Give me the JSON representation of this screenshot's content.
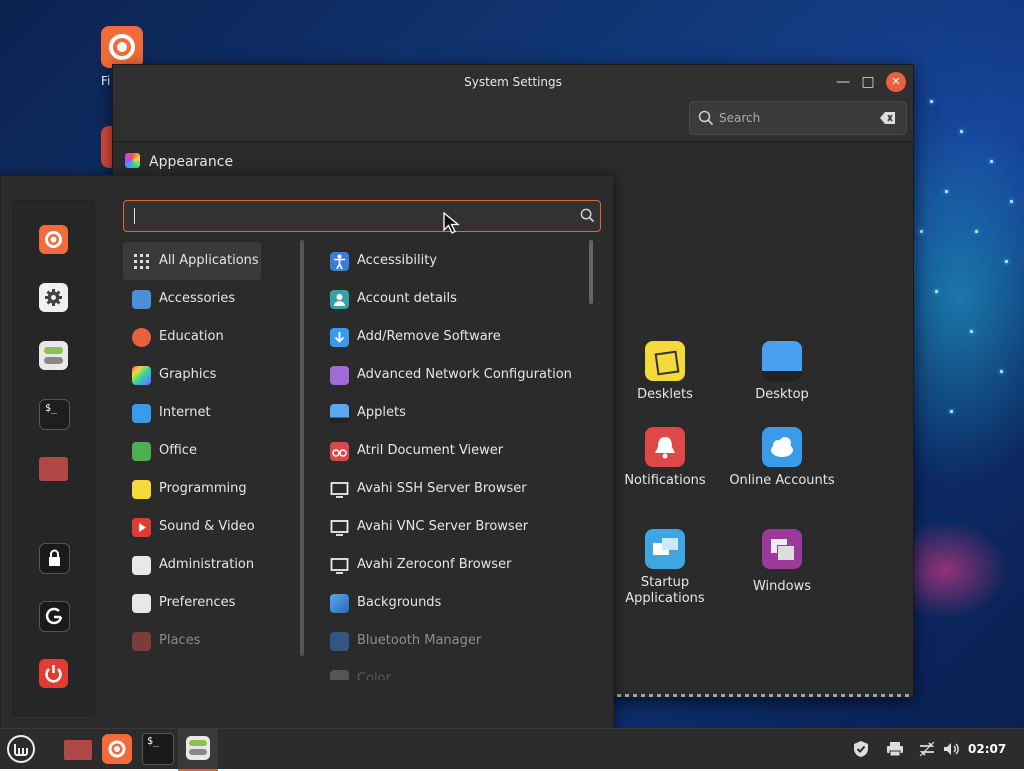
{
  "desktop": {
    "icons": [
      {
        "label": "Fi",
        "icon": "firefox-icon"
      },
      {
        "label": "",
        "icon": "chrome-icon"
      }
    ]
  },
  "settings_window": {
    "title": "System Settings",
    "search_placeholder": "Search",
    "section": "Appearance",
    "tiles": [
      {
        "label": "Desklets",
        "icon": "desklets-icon"
      },
      {
        "label": "Desktop",
        "icon": "desktop-icon"
      },
      {
        "label": "Notifications",
        "icon": "notifications-icon"
      },
      {
        "label": "Online Accounts",
        "icon": "online-accounts-icon"
      },
      {
        "label": "Startup Applications",
        "icon": "startup-applications-icon"
      },
      {
        "label": "Windows",
        "icon": "windows-icon"
      }
    ]
  },
  "menu": {
    "search_value": "",
    "favorites": [
      "firefox-icon",
      "settings-icon",
      "toggle-icon",
      "terminal-icon",
      "folder-icon",
      "lock-icon",
      "logout-icon",
      "power-icon"
    ],
    "categories": [
      {
        "label": "All Applications",
        "icon": "grid-icon",
        "selected": true
      },
      {
        "label": "Accessories",
        "icon": "accessories-icon"
      },
      {
        "label": "Education",
        "icon": "education-icon"
      },
      {
        "label": "Graphics",
        "icon": "graphics-icon"
      },
      {
        "label": "Internet",
        "icon": "internet-icon"
      },
      {
        "label": "Office",
        "icon": "office-icon"
      },
      {
        "label": "Programming",
        "icon": "programming-icon"
      },
      {
        "label": "Sound & Video",
        "icon": "sound-video-icon"
      },
      {
        "label": "Administration",
        "icon": "administration-icon"
      },
      {
        "label": "Preferences",
        "icon": "preferences-icon"
      },
      {
        "label": "Places",
        "icon": "places-icon",
        "dim": true
      }
    ],
    "apps": [
      {
        "label": "Accessibility",
        "icon": "accessibility-icon"
      },
      {
        "label": "Account details",
        "icon": "account-icon"
      },
      {
        "label": "Add/Remove Software",
        "icon": "software-icon"
      },
      {
        "label": "Advanced Network Configuration",
        "icon": "network-icon"
      },
      {
        "label": "Applets",
        "icon": "applets-icon"
      },
      {
        "label": "Atril Document Viewer",
        "icon": "atril-icon"
      },
      {
        "label": "Avahi SSH Server Browser",
        "icon": "monitor-icon"
      },
      {
        "label": "Avahi VNC Server Browser",
        "icon": "monitor-icon"
      },
      {
        "label": "Avahi Zeroconf Browser",
        "icon": "monitor-icon"
      },
      {
        "label": "Backgrounds",
        "icon": "backgrounds-icon"
      },
      {
        "label": "Bluetooth Manager",
        "icon": "bluetooth-icon",
        "dim": true
      },
      {
        "label": "Color",
        "icon": "color-icon",
        "dim": true
      }
    ]
  },
  "panel": {
    "clock": "02:07",
    "tray": [
      "shield-icon",
      "printer-icon",
      "network-icon",
      "volume-icon"
    ],
    "launchers": [
      "mint-menu-icon",
      "folder-icon",
      "firefox-icon",
      "terminal-icon",
      "settings-toggle-icon"
    ]
  },
  "colors": {
    "accent": "#e8603c",
    "panel": "#2c2c2c",
    "window": "#2b2b2b"
  }
}
